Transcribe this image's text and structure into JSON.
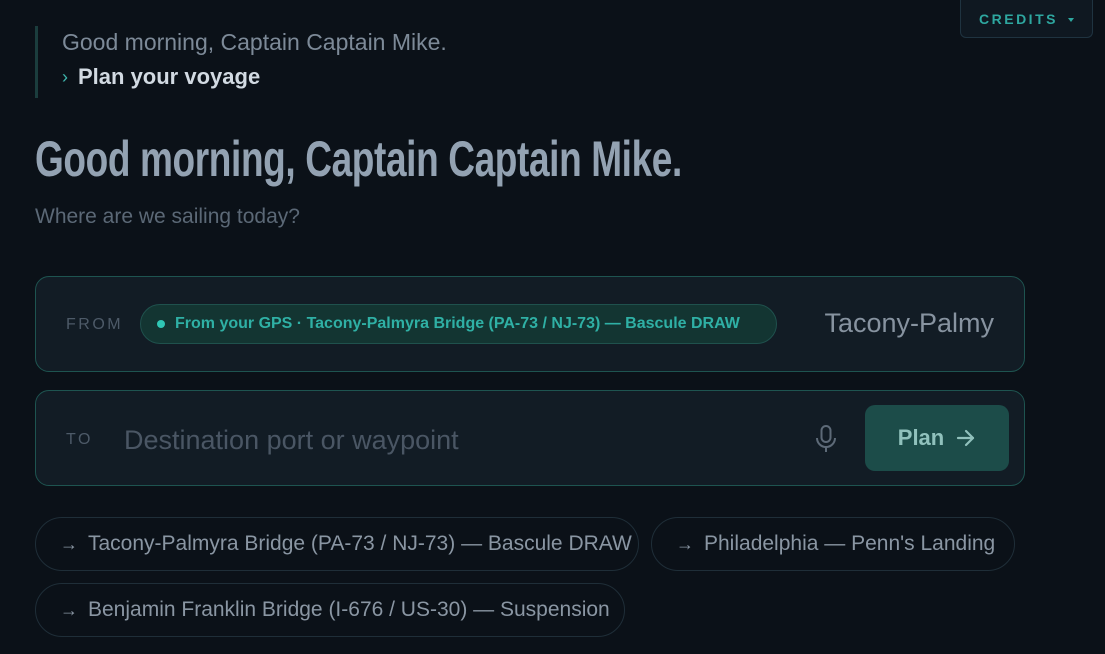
{
  "header": {
    "credits_label": "CREDITS"
  },
  "breadcrumb": {
    "greeting": "Good morning, Captain Captain Mike.",
    "current": "Plan your voyage"
  },
  "hero": {
    "title": "Good morning, Captain Captain Mike.",
    "subtitle": "Where are we sailing today?"
  },
  "from": {
    "label": "FROM",
    "gps_chip": "From your GPS · Tacony-Palmyra Bridge (PA-73 / NJ-73) — Bascule DRAW",
    "value": "Tacony-Palmy"
  },
  "to": {
    "label": "TO",
    "placeholder": "Destination port or waypoint",
    "value": "",
    "plan_label": "Plan"
  },
  "suggestions": [
    {
      "label": "Tacony-Palmyra Bridge (PA-73 / NJ-73) — Bascule DRAW"
    },
    {
      "label": "Philadelphia — Penn's Landing"
    },
    {
      "label": "Benjamin Franklin Bridge (I-676 / US-30) — Suspension"
    }
  ],
  "icons": {
    "chevron": "chevron-right-icon",
    "arrow": "arrow-right-icon",
    "mic": "microphone-icon",
    "caret": "caret-down-icon"
  },
  "colors": {
    "background": "#0b1118",
    "accent": "#2ea7a0",
    "field_border": "#1e5450",
    "plan_button": "#1c4c49"
  }
}
